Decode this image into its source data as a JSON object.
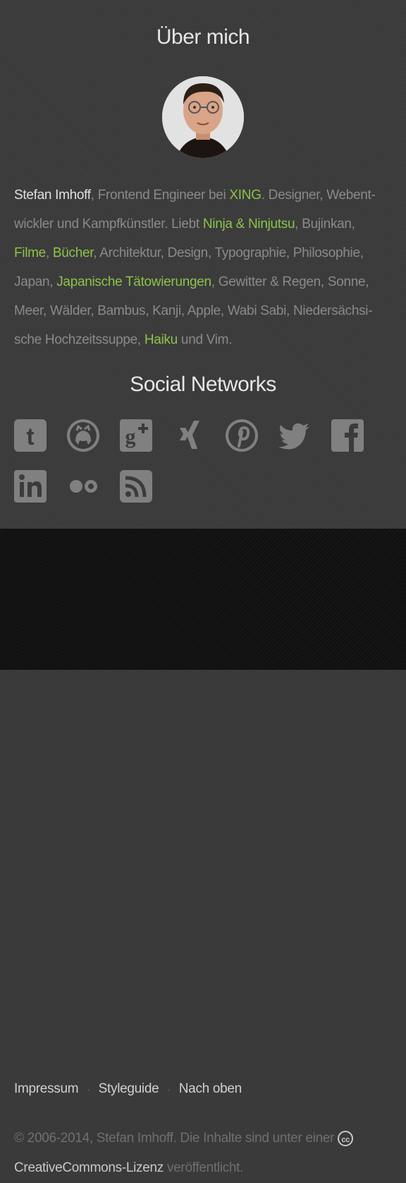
{
  "about": {
    "title": "Über mich",
    "bio": {
      "name": "Stefan Imhoff",
      "t1": ", Frontend Engineer bei ",
      "xing": "XING",
      "t2": ". Designer, Webent­wickler und Kampfkünstler. Liebt ",
      "ninja": "Ninja & Ninjutsu",
      "t3": ", Bujinkan, ",
      "filme": "Filme",
      "t4": ", ",
      "buecher": "Bücher",
      "t5": ", Architektur, Design, Typographie, Philosophie, Japan, ",
      "tattoo": "Japanische Tätowierungen",
      "t6": ", Gewitter & Regen, Sonne, Meer, Wälder, Bambus, Kanji, Apple, Wabi Sabi, Niedersächsi­sche Hochzeitssuppe, ",
      "haiku": "Haiku",
      "t7": " und Vim."
    }
  },
  "social": {
    "title": "Social Networks",
    "icons": [
      "tumblr-icon",
      "github-icon",
      "google-plus-icon",
      "xing-icon",
      "pinterest-icon",
      "twitter-icon",
      "facebook-icon",
      "linkedin-icon",
      "flickr-icon",
      "rss-icon"
    ],
    "icon_color": "#808080"
  },
  "footer": {
    "nav": [
      "Impressum",
      "Styleguide",
      "Nach oben"
    ],
    "separator": "·",
    "copyright": "© 2006-2014, Stefan Imhoff. Die Inhalte sind unter einer ",
    "license_link": "CreativeCommons-Lizenz",
    "license_suffix": " veröffentlicht."
  },
  "colors": {
    "accent": "#8bc34a",
    "background": "#3b3b3b",
    "footer_background": "#111111"
  }
}
